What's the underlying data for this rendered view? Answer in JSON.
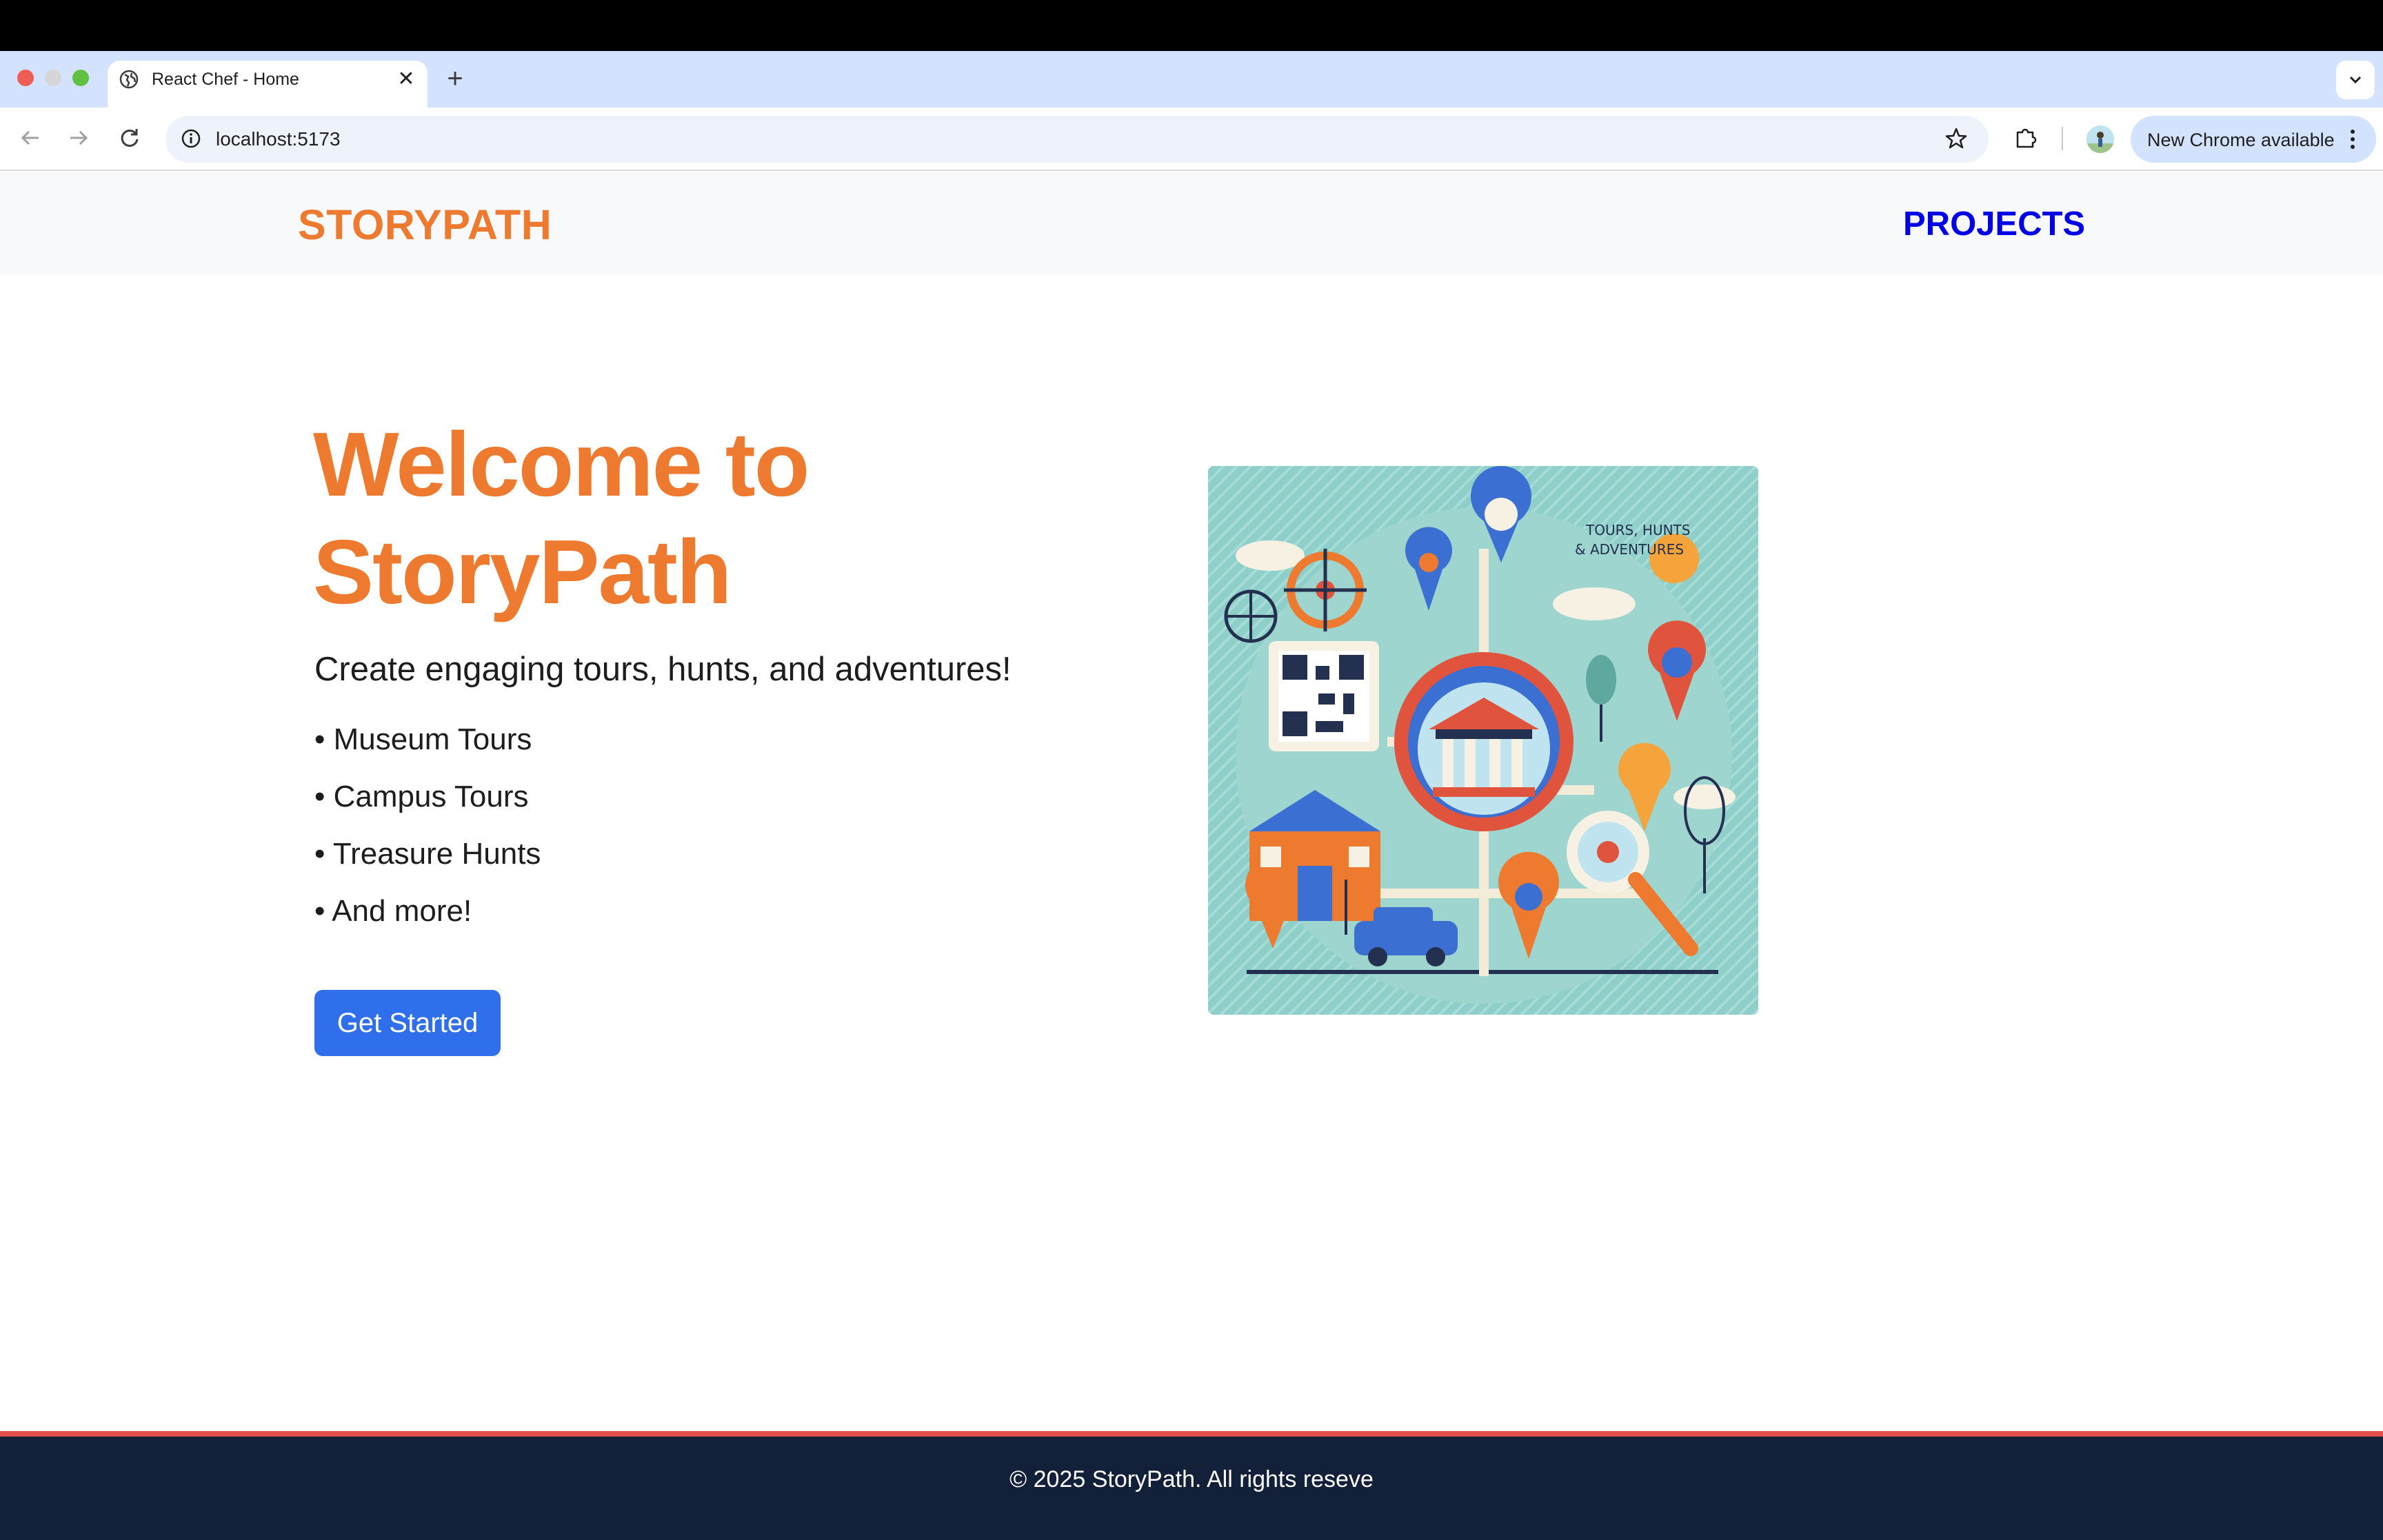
{
  "browser": {
    "tab": {
      "title": "React Chef - Home",
      "icon": "globe-icon"
    },
    "address_bar": {
      "url": "localhost:5173"
    },
    "update_button": {
      "label": "New Chrome available"
    }
  },
  "header": {
    "brand": "STORYPATH",
    "nav": {
      "projects": "PROJECTS"
    }
  },
  "hero": {
    "title": "Welcome to StoryPath",
    "subtitle": "Create engaging tours, hunts, and adventures!",
    "features": [
      "• Museum Tours",
      "• Campus Tours",
      "• Treasure Hunts",
      "• And more!"
    ],
    "cta": "Get Started",
    "image": {
      "caption": "TOURS, HUNTS & ADVENTURES"
    }
  },
  "footer": {
    "copyright": "© 2025 StoryPath. All rights reseve"
  },
  "colors": {
    "brand_orange": "#ee7a2f",
    "nav_blue": "#0000e6",
    "button_blue": "#2f6fec",
    "footer_bg": "#12203a",
    "footer_accent": "#e2504a"
  }
}
